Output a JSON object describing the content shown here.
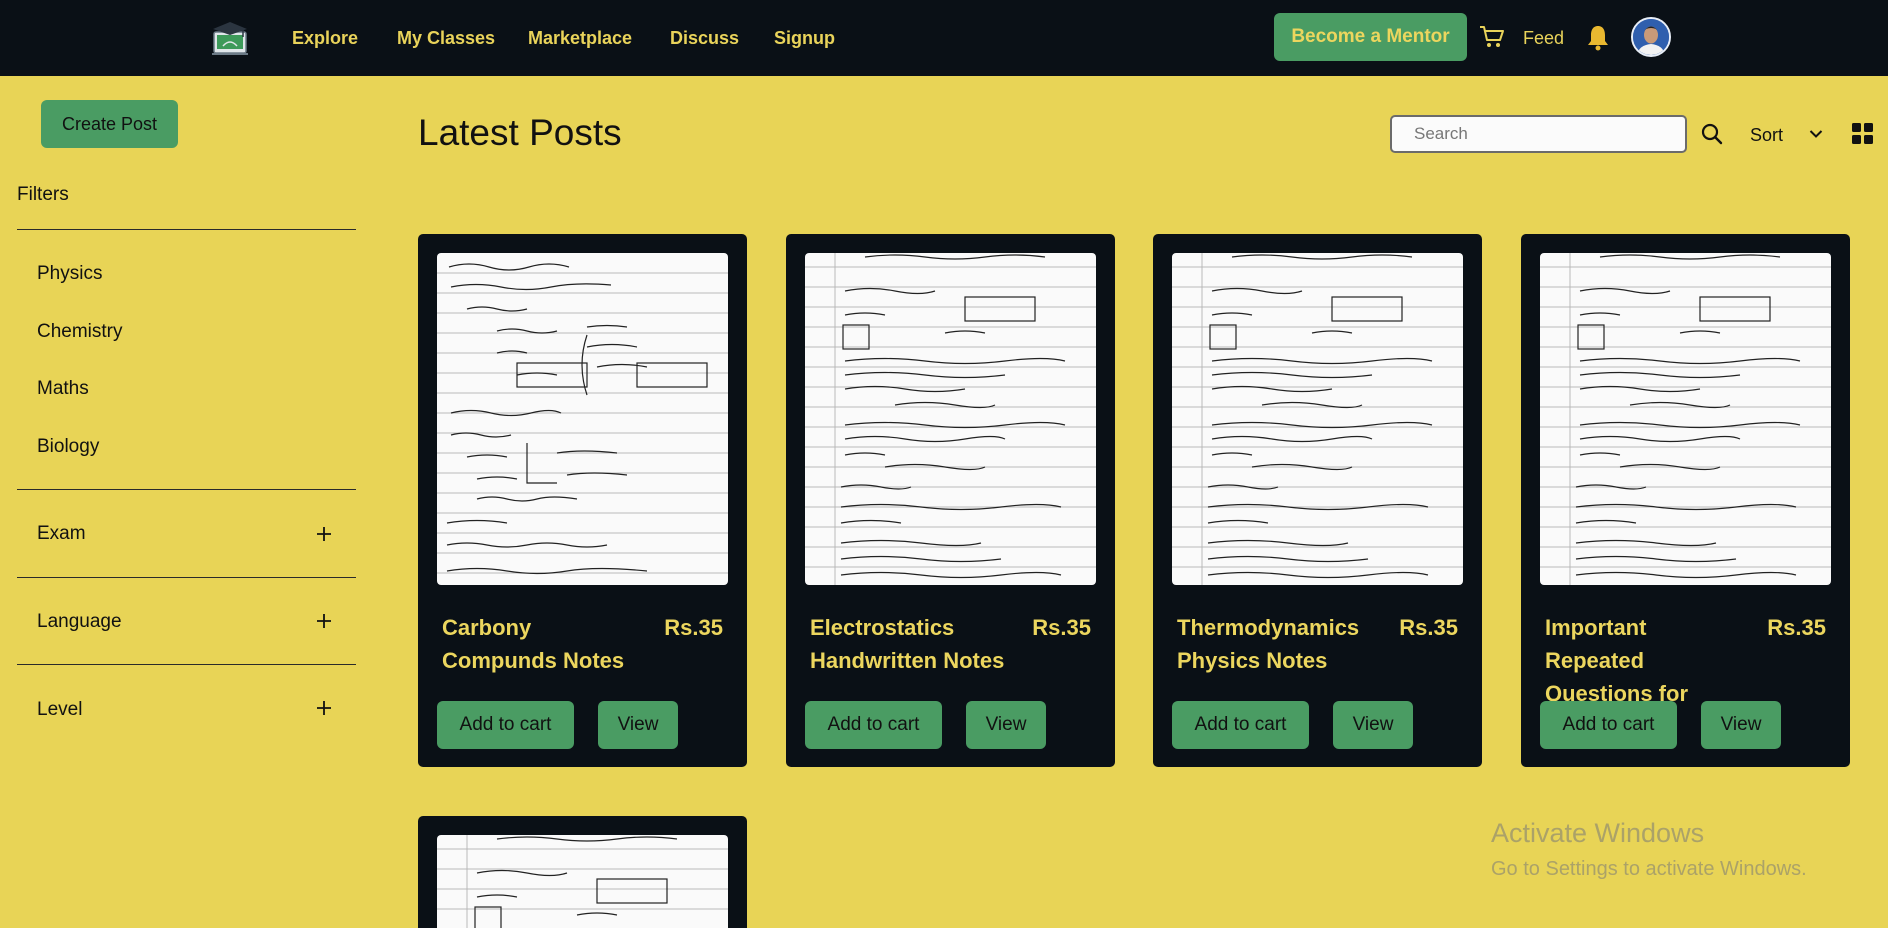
{
  "navbar": {
    "links": [
      "Explore",
      "My Classes",
      "Marketplace",
      "Discuss",
      "Signup"
    ],
    "mentor_button": "Become a Mentor",
    "feed": "Feed"
  },
  "sidebar": {
    "create_post": "Create Post",
    "filters_title": "Filters",
    "subjects": [
      "Physics",
      "Chemistry",
      "Maths",
      "Biology"
    ],
    "accordions": [
      "Exam",
      "Language",
      "Level"
    ]
  },
  "main": {
    "title": "Latest Posts",
    "search_placeholder": "Search",
    "sort_label": "Sort"
  },
  "posts": [
    {
      "title": "Carbony Compunds Notes",
      "price": "Rs.35",
      "add_label": "Add to cart",
      "view_label": "View"
    },
    {
      "title": "Electrostatics Handwritten Notes",
      "price": "Rs.35",
      "add_label": "Add to cart",
      "view_label": "View"
    },
    {
      "title": "Thermodynamics Physics Notes",
      "price": "Rs.35",
      "add_label": "Add to cart",
      "view_label": "View"
    },
    {
      "title": "Important Repeated Questions for NEET",
      "price": "Rs.35",
      "add_label": "Add to cart",
      "view_label": "View"
    }
  ],
  "watermark": {
    "title": "Activate Windows",
    "subtitle": "Go to Settings to activate Windows."
  },
  "colors": {
    "background": "#e8d456",
    "dark": "#0a1016",
    "accent_green": "#4a9c63",
    "accent_yellow": "#ecd65e"
  },
  "icons": [
    "logo-icon",
    "cart-icon",
    "bell-icon",
    "avatar",
    "plus-icon",
    "search-icon",
    "chevron-down-icon",
    "grid-icon"
  ]
}
